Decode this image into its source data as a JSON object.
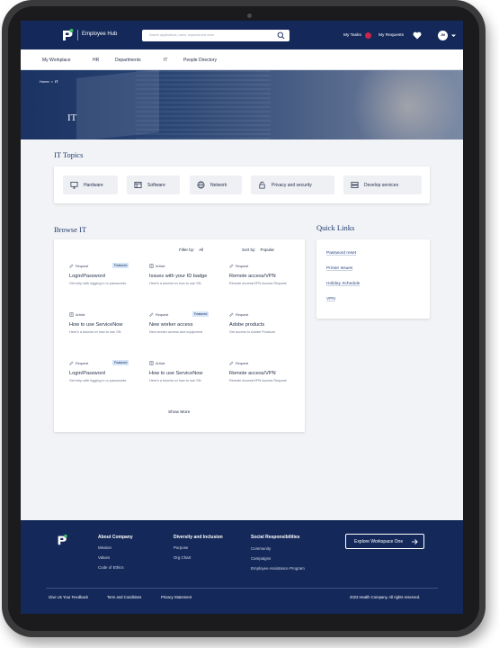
{
  "header": {
    "app_title": "Employee Hub",
    "search_placeholder": "Search applications, users, requests and more",
    "my_tasks": "My Tasks",
    "my_requests": "My Requests",
    "avatar_initials": "JM"
  },
  "subnav": [
    "My Workplace",
    "HR",
    "Departments",
    "IT",
    "People Directory"
  ],
  "hero": {
    "breadcrumb_home": "Home",
    "breadcrumb_sep": ">",
    "breadcrumb_current": "IT",
    "title": "IT"
  },
  "topics": {
    "title": "IT Topics",
    "items": [
      {
        "label": "Hardware",
        "icon": "monitor-icon"
      },
      {
        "label": "Software",
        "icon": "window-icon"
      },
      {
        "label": "Network",
        "icon": "globe-icon"
      },
      {
        "label": "Privacy and security",
        "icon": "lock-icon"
      },
      {
        "label": "Develop services",
        "icon": "server-icon"
      }
    ]
  },
  "browse": {
    "title": "Browse IT",
    "filter_label": "Filter by:",
    "filter_value": "All",
    "sort_label": "Sort by:",
    "sort_value": "Popular",
    "show_more": "Show More",
    "featured_label": "Featured",
    "cards": [
      {
        "type": "Request",
        "featured": true,
        "title": "Login/Password",
        "desc": "Get help with logging in or passwords."
      },
      {
        "type": "Article",
        "featured": false,
        "title": "Issues with your ID badge",
        "desc": "Here's a tutorial on how to use SN"
      },
      {
        "type": "Request",
        "featured": false,
        "title": "Remote access/VPN",
        "desc": "Remote Access/VPN Access Request"
      },
      {
        "type": "Article",
        "featured": false,
        "title": "How to use ServiceNow",
        "desc": "Here's a tutorial on how to use SN"
      },
      {
        "type": "Request",
        "featured": true,
        "title": "New worker access",
        "desc": "New worker access and equipment"
      },
      {
        "type": "Request",
        "featured": false,
        "title": "Adobe products",
        "desc": "Get access to Adobe Products"
      },
      {
        "type": "Request",
        "featured": true,
        "title": "Login/Password",
        "desc": "Get help with logging in or passwords."
      },
      {
        "type": "Article",
        "featured": false,
        "title": "How to use ServiceNow",
        "desc": "Here's a tutorial on how to use SN"
      },
      {
        "type": "Request",
        "featured": false,
        "title": "Remote access/VPN",
        "desc": "Remote Access/VPN Access Request"
      }
    ]
  },
  "quick_links": {
    "title": "Quick Links",
    "items": [
      "Password reset",
      "Printer Issues",
      "Holiday Schedule",
      "VPN"
    ]
  },
  "footer": {
    "about": {
      "title": "About Company",
      "links": [
        "Mission",
        "Values",
        "Code of Ethics"
      ]
    },
    "diversity": {
      "title": "Diversity and Inclusion",
      "links": [
        "Purpose",
        "Org Chart"
      ]
    },
    "social": {
      "title": "Social Responsibilities",
      "links": [
        "Community",
        "Campaigns",
        "Employee Assistance Program"
      ]
    },
    "cta": "Explore Workspace One",
    "bottom_links": [
      "Give Us Your Feedback",
      "Term and Conditions",
      "Privacy Statement"
    ],
    "copyright": "2023 Health Company. All rights reserved."
  },
  "colors": {
    "navy": "#14295a",
    "accent_red": "#c8264a",
    "featured_bg": "#d7e6f7",
    "link": "#2b4680"
  }
}
